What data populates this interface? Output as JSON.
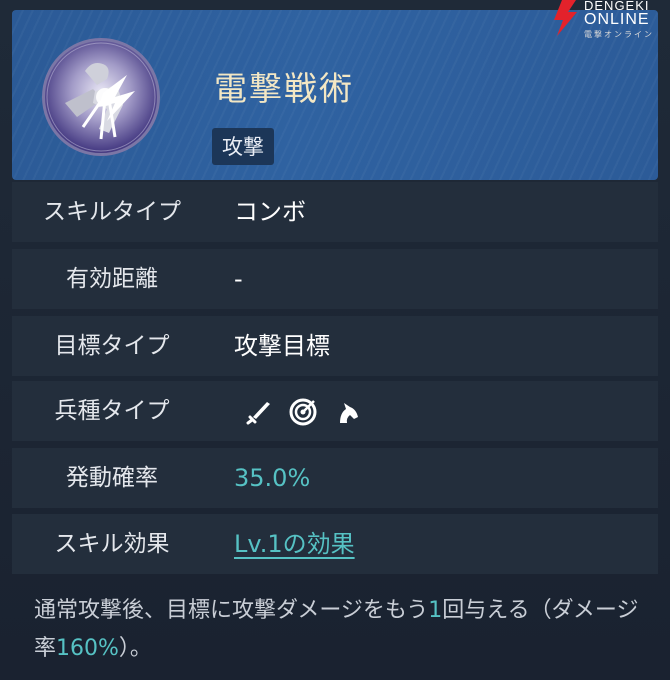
{
  "skill": {
    "name": "電撃戦術",
    "tag": "攻撃",
    "avatar_icon": "lightning-strike-icon"
  },
  "rows": [
    {
      "label": "スキルタイプ",
      "value": "コンボ"
    },
    {
      "label": "有効距離",
      "value": "-"
    },
    {
      "label": "目標タイプ",
      "value": "攻撃目標"
    },
    {
      "label": "兵種タイプ",
      "icons": [
        "sword-icon",
        "target-icon",
        "cavalry-icon"
      ]
    },
    {
      "label": "発動確率",
      "value": "35.0%"
    },
    {
      "label": "スキル効果",
      "value": "Lv.1の効果"
    }
  ],
  "description": {
    "part1": "通常攻撃後、目標に攻撃ダメージをもう",
    "num1": "1",
    "part2": "回与える（ダメージ率",
    "num2": "160%",
    "part3": "）。"
  },
  "logo": {
    "line1": "DENGEKI",
    "line2": "ONLINE",
    "line3": "電撃オンライン"
  },
  "colors": {
    "header_bg": "#2f62a1",
    "title": "#f3e7c4",
    "accent": "#56c2c4",
    "row_bg": "#232e3c",
    "logo_red": "#e3222b"
  }
}
